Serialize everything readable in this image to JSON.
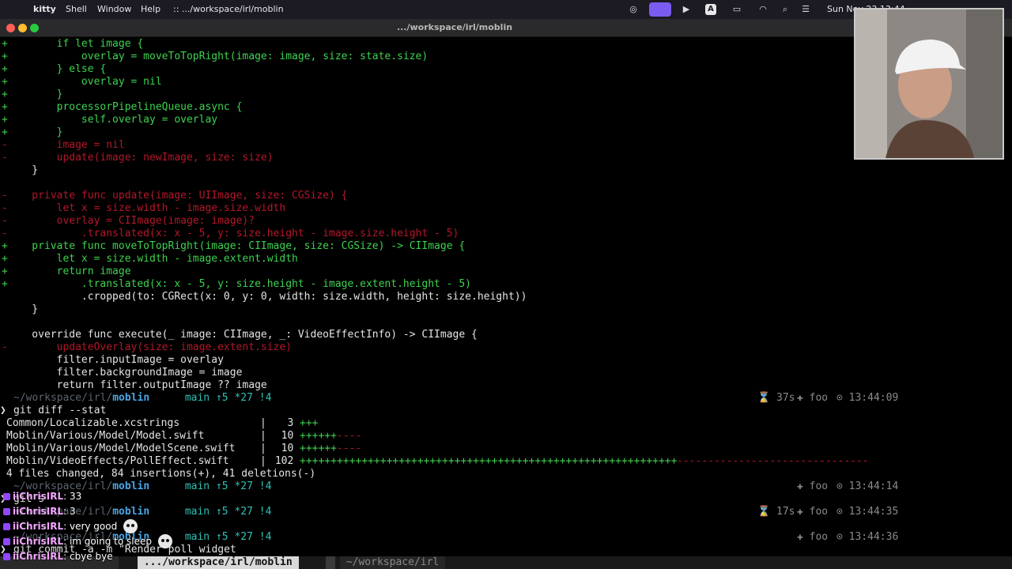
{
  "menubar": {
    "app": "kitty",
    "items": [
      "Shell",
      "Window",
      "Help"
    ],
    "path": ":: .../workspace/irl/moblin",
    "clock": "Sun Nov 23 13:44"
  },
  "window": {
    "title": ".../workspace/irl/moblin"
  },
  "diff_lines": [
    {
      "m": "+",
      "c": "green",
      "t": "        if let image {"
    },
    {
      "m": "+",
      "c": "green",
      "t": "            overlay = moveToTopRight(image: image, size: state.size)"
    },
    {
      "m": "+",
      "c": "green",
      "t": "        } else {"
    },
    {
      "m": "+",
      "c": "green",
      "t": "            overlay = nil"
    },
    {
      "m": "+",
      "c": "green",
      "t": "        }"
    },
    {
      "m": "+",
      "c": "green",
      "t": "        processorPipelineQueue.async {"
    },
    {
      "m": "+",
      "c": "green",
      "t": "            self.overlay = overlay"
    },
    {
      "m": "+",
      "c": "green",
      "t": "        }"
    },
    {
      "m": "-",
      "c": "red",
      "t": "        image = nil"
    },
    {
      "m": "-",
      "c": "red",
      "t": "        update(image: newImage, size: size)"
    },
    {
      "m": "",
      "c": "white",
      "t": "    }"
    },
    {
      "m": "",
      "c": "white",
      "t": ""
    },
    {
      "m": "-",
      "c": "red",
      "t": "    private func update(image: UIImage, size: CGSize) {"
    },
    {
      "m": "-",
      "c": "red",
      "t": "        let x = size.width - image.size.width"
    },
    {
      "m": "-",
      "c": "red",
      "t": "        overlay = CIImage(image: image)?"
    },
    {
      "m": "-",
      "c": "red",
      "t": "            .translated(x: x - 5, y: size.height - image.size.height - 5)"
    },
    {
      "m": "+",
      "c": "green",
      "t": "    private func moveToTopRight(image: CIImage, size: CGSize) -> CIImage {"
    },
    {
      "m": "+",
      "c": "green",
      "t": "        let x = size.width - image.extent.width"
    },
    {
      "m": "+",
      "c": "green",
      "t": "        return image"
    },
    {
      "m": "+",
      "c": "green",
      "t": "            .translated(x: x - 5, y: size.height - image.extent.height - 5)"
    },
    {
      "m": "",
      "c": "white",
      "t": "            .cropped(to: CGRect(x: 0, y: 0, width: size.width, height: size.height))"
    },
    {
      "m": "",
      "c": "white",
      "t": "    }"
    },
    {
      "m": "",
      "c": "white",
      "t": ""
    },
    {
      "m": "",
      "c": "white",
      "t": "    override func execute(_ image: CIImage, _: VideoEffectInfo) -> CIImage {"
    },
    {
      "m": "-",
      "c": "red",
      "t": "        updateOverlay(size: image.extent.size)"
    },
    {
      "m": "",
      "c": "white",
      "t": "        filter.inputImage = overlay"
    },
    {
      "m": "",
      "c": "white",
      "t": "        filter.backgroundImage = image"
    },
    {
      "m": "",
      "c": "white",
      "t": "        return filter.outputImage ?? image"
    }
  ],
  "prompts": [
    {
      "path_prefix": "~/workspace/irl/",
      "dir": "moblin",
      "branch": " main ↑5 *27 !4",
      "duration": "37s",
      "host": "foo",
      "time": "13:44:09"
    },
    {
      "path_prefix": "~/workspace/irl/",
      "dir": "moblin",
      "branch": " main ↑5 *27 !4",
      "duration": "",
      "host": "foo",
      "time": "13:44:14"
    },
    {
      "path_prefix": "~/workspace/irl/",
      "dir": "moblin",
      "branch": " main ↑5 *27 !4",
      "duration": "17s",
      "host": "foo",
      "time": "13:44:35"
    },
    {
      "path_prefix": "~/workspace/irl/",
      "dir": "moblin",
      "branch": " main ↑5 *27 !4",
      "duration": "",
      "host": "foo",
      "time": "13:44:36"
    }
  ],
  "commands": {
    "diffstat": "git diff --stat",
    "status": "git s",
    "commit": "git commit -a -m \"Render poll widget "
  },
  "diffstat": [
    {
      "file": "Common/Localizable.xcstrings        ",
      "count": "   3",
      "plus": "+++",
      "minus": ""
    },
    {
      "file": "Moblin/Various/Model/Model.swift    ",
      "count": "  10",
      "plus": "++++++",
      "minus": "----"
    },
    {
      "file": "Moblin/Various/Model/ModelScene.swift",
      "count": "  10",
      "plus": "++++++",
      "minus": "----"
    },
    {
      "file": "Moblin/VideoEffects/PollEffect.swift ",
      "count": " 102",
      "plus": "+++++++++++++++++++++++++++++++++++++++++++++++++++++++++++++",
      "minus": "-------------------------------"
    }
  ],
  "diffstat_summary": " 4 files changed, 84 insertions(+), 41 deletions(-)",
  "tabs": [
    {
      "label": " .../workspace/irl/moblin ",
      "active": true
    },
    {
      "label": " ~/workspace/irl ",
      "active": false
    }
  ],
  "chat": [
    {
      "user": "iiChrisIRL",
      "msg": "33",
      "emote": false
    },
    {
      "user": "iiChrisIRL",
      "msg": "3",
      "emote": false
    },
    {
      "user": "iiChrisIRL",
      "msg": "very good",
      "emote": true
    },
    {
      "user": "iiChrisIRL",
      "msg": "im going to sleep",
      "emote": true
    },
    {
      "user": "iiChrisIRL",
      "msg": "cbye bye",
      "emote": false
    }
  ],
  "icons": [
    "apple-logo-icon",
    "screen-share-icon",
    "play-icon",
    "battery-icon",
    "wifi-icon",
    "search-icon",
    "control-center-icon"
  ],
  "colors": {
    "added": "#3ed250",
    "removed": "#b3172a",
    "dir": "#4aa6e6",
    "accent": "#7a5cf0"
  }
}
